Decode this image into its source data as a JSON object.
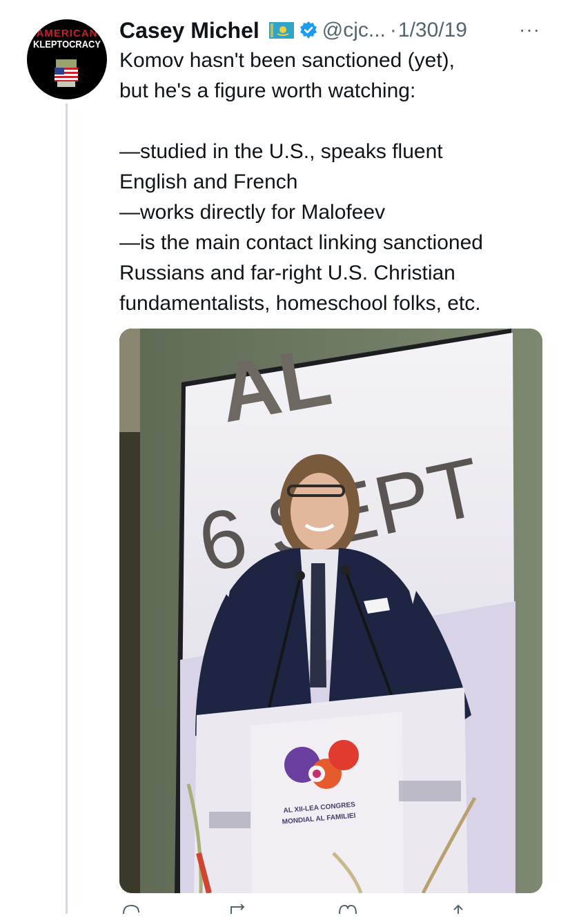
{
  "avatar": {
    "line1": "AMERICAN",
    "line2": "KLEPTOCRACY",
    "icon": "money-flag-icon"
  },
  "header": {
    "name": "Casey Michel",
    "flag_icon": "kazakhstan-flag-icon",
    "verified_icon": "verified-badge-icon",
    "handle": "@cjc...",
    "separator": "·",
    "date": "1/30/19",
    "more_icon": "more-icon",
    "more_glyph": "···"
  },
  "tweet": {
    "line1": "Komov hasn't been sanctioned (yet),",
    "line2": "but he's a figure worth watching:",
    "line3": "—studied in the U.S., speaks fluent",
    "line4": "English and French",
    "line5": "—works directly for Malofeev",
    "line6": "—is the main contact linking sanctioned",
    "line7": "Russians and far-right U.S. Christian",
    "line8": "fundamentalists, homeschool folks, etc."
  },
  "media": {
    "screen_text": "6 SEPT",
    "screen_text_top": "AL",
    "podium_line1": "AL XII-LEA CONGRES",
    "podium_line2": "MONDIAL AL FAMILIEI"
  },
  "actions": [
    "reply-icon",
    "retweet-icon",
    "like-icon",
    "share-icon"
  ],
  "colors": {
    "secondary": "#536471",
    "verified": "#1d9bf0",
    "thread": "#cfd9de"
  }
}
